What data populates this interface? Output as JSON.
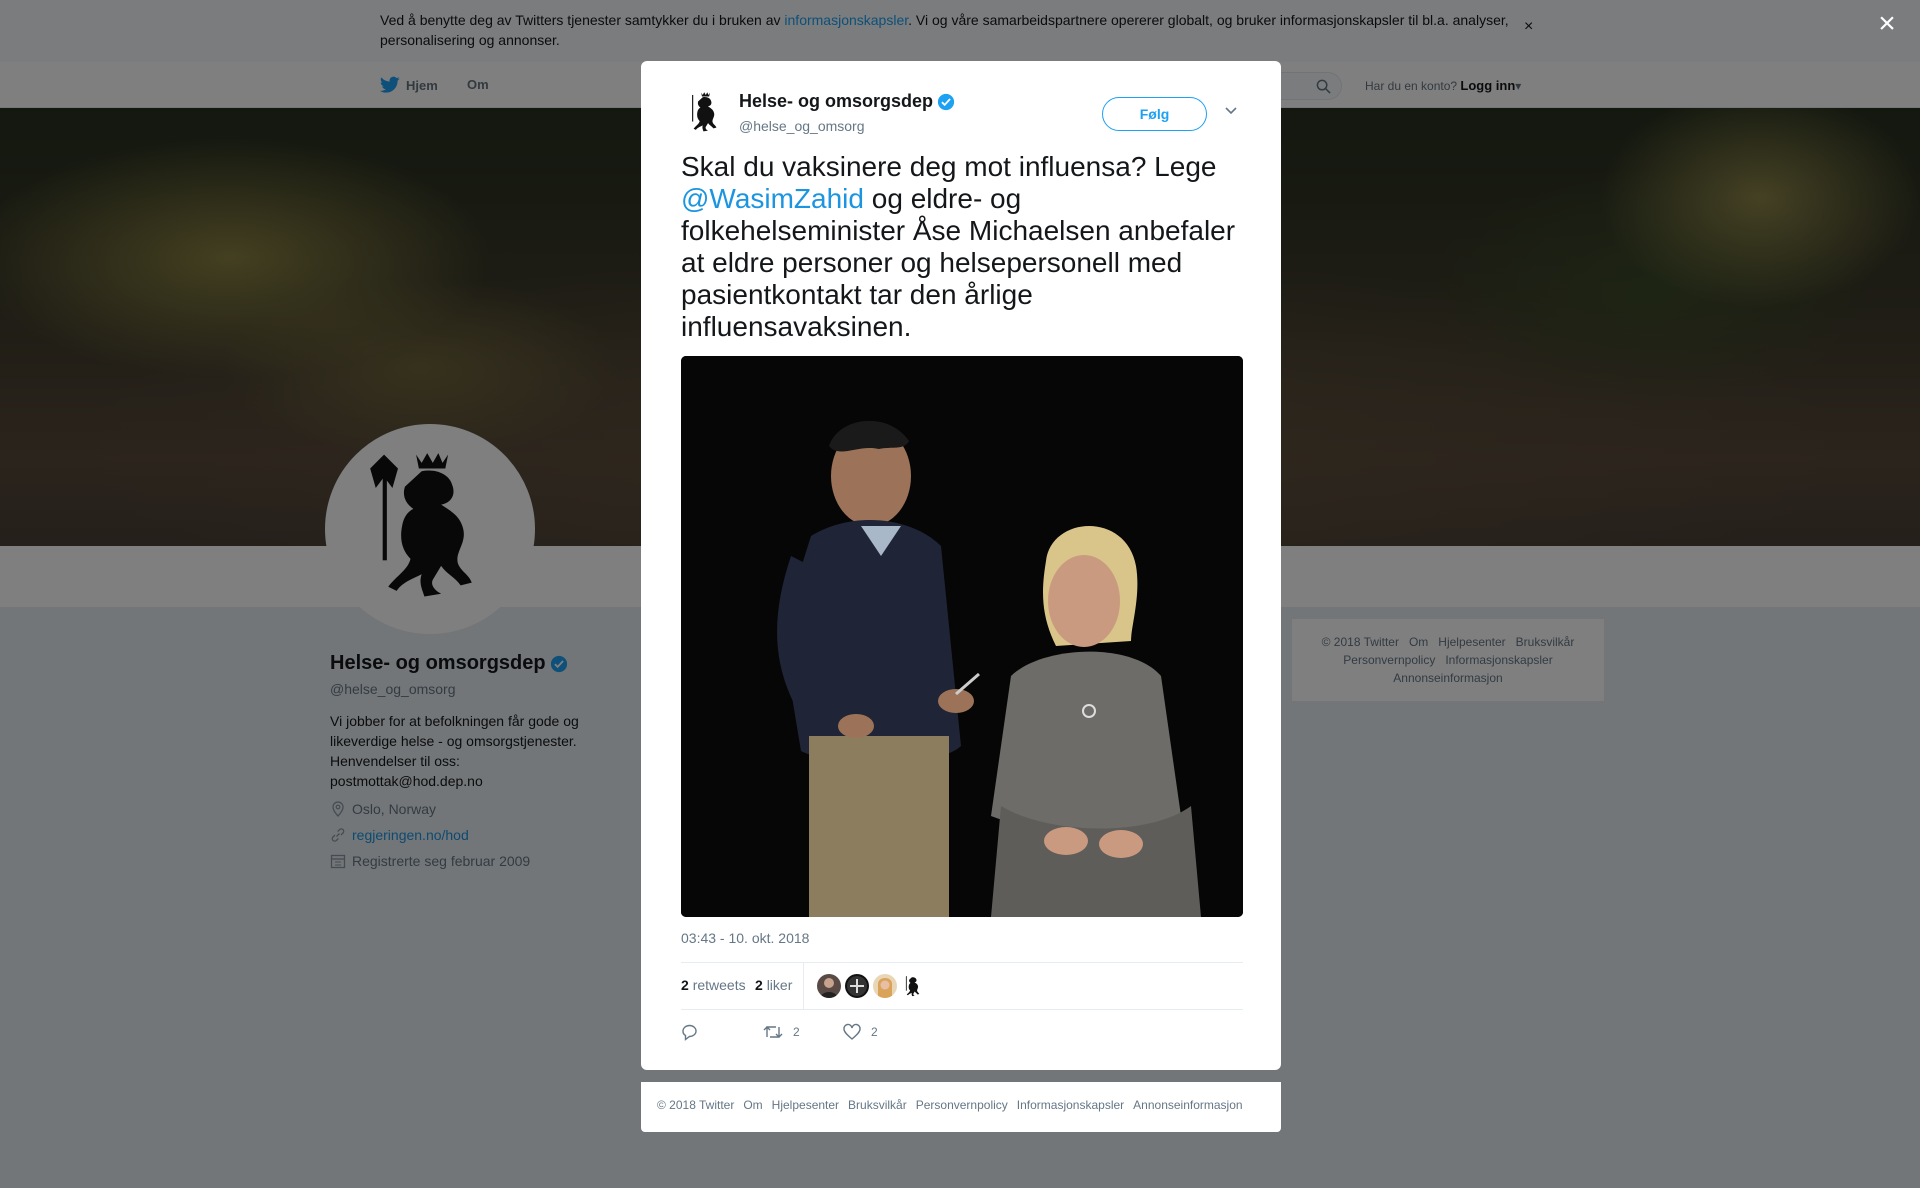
{
  "cookie_bar": {
    "text_before": "Ved å benytte deg av Twitters tjenester samtykker du i bruken av ",
    "link": "informasjonskapsler",
    "text_after": ". Vi og våre samarbeidspartnere opererer globalt, og bruker informasjonskapsler til bl.a. analyser, personalisering og annonser.",
    "close": "×"
  },
  "nav": {
    "home": "Hjem",
    "about": "Om",
    "login_prompt": "Har du en konto?",
    "login": "Logg inn"
  },
  "profile": {
    "name": "Helse- og omsorgsdep",
    "handle": "@helse_og_omsorg",
    "bio": "Vi jobber for at befolkningen får gode og likeverdige helse - og omsorgstjenester. Henvendelser til oss: postmottak@hod.dep.no",
    "location": "Oslo, Norway",
    "website": "regjeringen.no/hod",
    "joined": "Registrerte seg februar 2009"
  },
  "side_footer": [
    "© 2018 Twitter",
    "Om",
    "Hjelpesenter",
    "Bruksvilkår",
    "Personvernpolicy",
    "Informasjonskapsler",
    "Annonseinformasjon"
  ],
  "modal": {
    "close": "×",
    "author_name": "Helse- og omsorgsdep",
    "author_handle": "@helse_og_omsorg",
    "follow_label": "Følg",
    "text_part1": "Skal du vaksinere deg mot influensa? Lege ",
    "mention": "@WasimZahid",
    "text_part2": " og eldre- og folkehelseminister Åse Michaelsen anbefaler at eldre personer og helsepersonell med pasientkontakt tar den årlige influensavaksinen.",
    "timestamp": "03:43 - 10. okt. 2018",
    "retweets_count": "2",
    "retweets_label": "retweets",
    "likes_count": "2",
    "likes_label": "liker",
    "action_retweet_count": "2",
    "action_like_count": "2"
  },
  "modal_footer": [
    "© 2018 Twitter",
    "Om",
    "Hjelpesenter",
    "Bruksvilkår",
    "Personvernpolicy",
    "Informasjonskapsler",
    "Annonseinformasjon"
  ],
  "colors": {
    "twitter_blue": "#1da1f2",
    "link_blue": "#1b95e0",
    "muted": "#657786",
    "verified": "#1da1f2"
  }
}
